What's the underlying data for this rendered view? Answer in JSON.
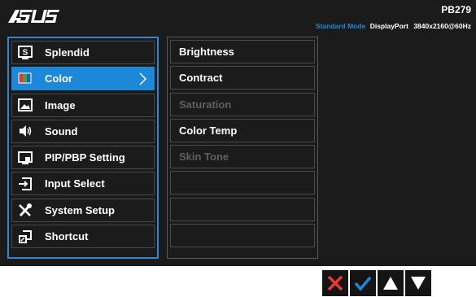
{
  "header": {
    "model": "PB279",
    "mode": "Standard Mode",
    "input": "DisplayPort",
    "resolution": "3840x2160@60Hz"
  },
  "menu": [
    {
      "label": "Splendid",
      "icon": "splendid-icon",
      "selected": false
    },
    {
      "label": "Color",
      "icon": "color-icon",
      "selected": true
    },
    {
      "label": "Image",
      "icon": "image-icon",
      "selected": false
    },
    {
      "label": "Sound",
      "icon": "speaker-icon",
      "selected": false
    },
    {
      "label": "PIP/PBP Setting",
      "icon": "pip-icon",
      "selected": false
    },
    {
      "label": "Input Select",
      "icon": "input-icon",
      "selected": false
    },
    {
      "label": "System Setup",
      "icon": "wrench-icon",
      "selected": false
    },
    {
      "label": "Shortcut",
      "icon": "shortcut-icon",
      "selected": false
    }
  ],
  "submenu": [
    {
      "label": "Brightness",
      "enabled": true
    },
    {
      "label": "Contract",
      "enabled": true
    },
    {
      "label": "Saturation",
      "enabled": false
    },
    {
      "label": "Color Temp",
      "enabled": true
    },
    {
      "label": "Skin Tone",
      "enabled": false
    },
    {
      "label": "",
      "enabled": true
    },
    {
      "label": "",
      "enabled": true
    },
    {
      "label": "",
      "enabled": true
    }
  ],
  "colors": {
    "accent": "#1e88d8",
    "close": "#e53935",
    "confirm": "#1e88d8",
    "osd_bg": "#1b1b1b",
    "disabled_text": "#5f5f5f"
  },
  "keys": [
    "close-icon",
    "check-icon",
    "up-arrow-icon",
    "down-arrow-icon"
  ]
}
